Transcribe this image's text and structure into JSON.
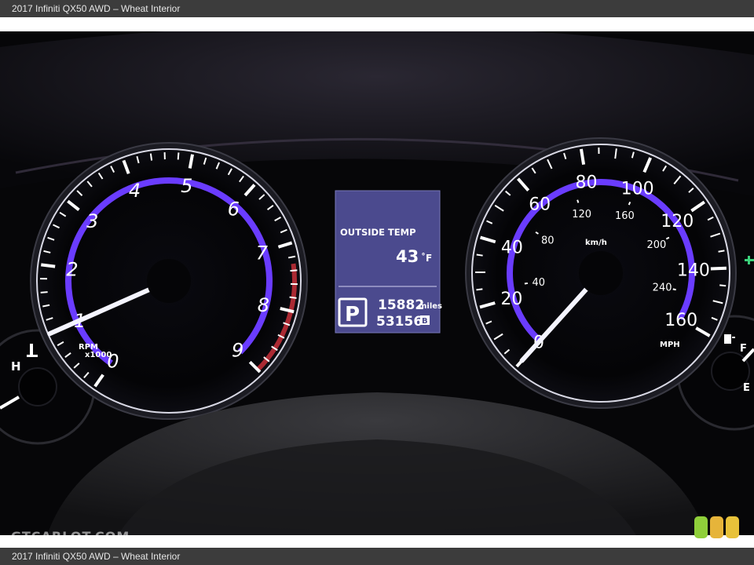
{
  "caption": {
    "top": "2017 Infiniti QX50 AWD – Wheat Interior",
    "bottom": "2017 Infiniti QX50 AWD – Wheat Interior"
  },
  "tachometer": {
    "numbers": [
      "0",
      "1",
      "2",
      "3",
      "4",
      "5",
      "6",
      "7",
      "8",
      "9"
    ],
    "unit_line1": "RPM",
    "unit_line2": "x1000",
    "needle_value": 1
  },
  "speedometer": {
    "mph_numbers": [
      "0",
      "20",
      "40",
      "60",
      "80",
      "100",
      "120",
      "140",
      "160"
    ],
    "kmh_numbers": [
      "40",
      "80",
      "120",
      "160",
      "200",
      "240"
    ],
    "kmh_label": "km/h",
    "mph_label": "MPH",
    "needle_value": 0
  },
  "display": {
    "outside_temp_label": "OUTSIDE TEMP",
    "temp_value": "43",
    "temp_unit": "˚F",
    "gear": "P",
    "odometer": "15882",
    "odometer_unit": "miles",
    "trip": "53156",
    "trip_unit": "B"
  },
  "temp_gauge": {
    "hot_label": "H"
  },
  "fuel_gauge": {
    "full_label": "F",
    "empty_label": "E"
  },
  "watermark": "GTCARLOT.COM",
  "colors": {
    "ring": "#6a3cff",
    "needle": "#f4f4ff",
    "lcd": "#4b4a8e",
    "dot1": "#8fcf3a",
    "dot2": "#e6b43a",
    "dot3": "#e8c23a"
  }
}
